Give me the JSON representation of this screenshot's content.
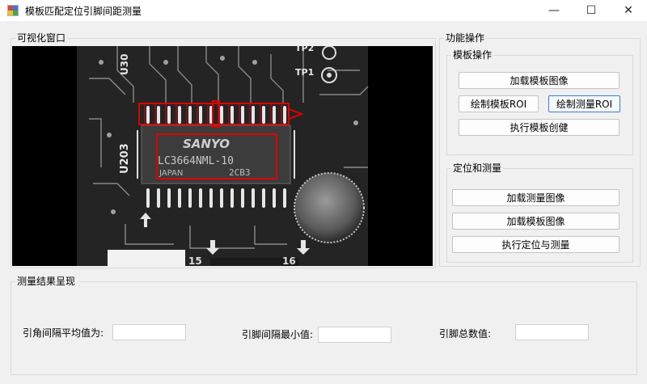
{
  "window": {
    "title": "模板匹配定位引脚间距测量",
    "minimize": "—",
    "maximize": "☐",
    "close": "✕"
  },
  "visual": {
    "group_label": "可视化窗口"
  },
  "image_text": {
    "brand": "SANYO",
    "part": "LC3664NML-10",
    "origin": "JAPAN",
    "code": "2CB3",
    "ref_u203": "U203",
    "ref_u30": "U30",
    "tp2": "TP2",
    "tp1": "TP1",
    "pad_15": "15",
    "pad_16": "16"
  },
  "functions": {
    "group_label": "功能操作",
    "template_ops": {
      "label": "模板操作",
      "load_template_image": "加载模板图像",
      "draw_template_roi": "绘制模板ROI",
      "draw_measure_roi": "绘制测量ROI",
      "create_template": "执行模板创健"
    },
    "locate_measure": {
      "label": "定位和测量",
      "load_measure_image": "加载测量图像",
      "load_template_image": "加载模板图像",
      "run_locate_measure": "执行定位与测量"
    }
  },
  "results": {
    "group_label": "测量结果呈现",
    "avg_spacing_label": "引角间隔平均值为:",
    "avg_spacing_value": "",
    "min_spacing_label": "引脚间隔最小值:",
    "min_spacing_value": "",
    "pin_count_label": "引脚总数值:",
    "pin_count_value": ""
  },
  "colors": {
    "roi": "#e00000",
    "accent": "#3a7bd5"
  }
}
